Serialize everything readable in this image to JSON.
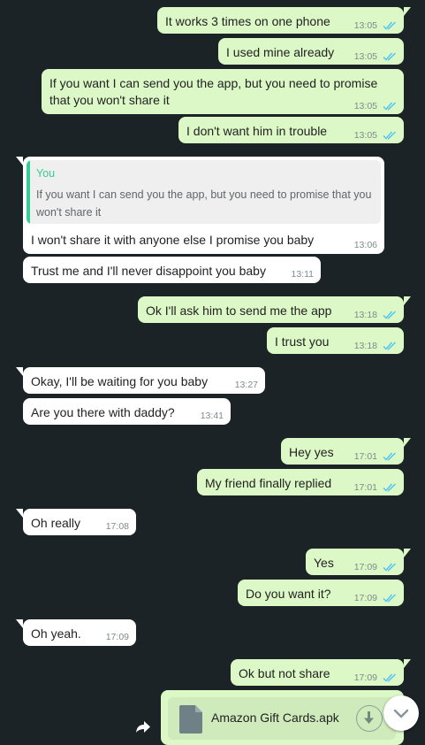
{
  "messages": [
    {
      "text": "It works 3 times on one phone",
      "time": "13:05"
    },
    {
      "text": "I used mine already",
      "time": "13:05"
    },
    {
      "text_line1": "If you want I can send you the app, but you need to promise",
      "text_line2": "that you won't share it",
      "time": "13:05"
    },
    {
      "text": "I don't want him in trouble",
      "time": "13:05"
    },
    {
      "quote_author": "You",
      "quote_text": "If you want I can send you the app, but you need to promise that you won't share it",
      "text": "I won't share it with anyone else I promise you baby",
      "time": "13:06"
    },
    {
      "text": "Trust me and I'll never disappoint you baby",
      "time": "13:11"
    },
    {
      "text": "Ok I'll ask him to send me the app",
      "time": "13:18"
    },
    {
      "text": "I trust you",
      "time": "13:18"
    },
    {
      "text": "Okay, I'll be waiting for you baby",
      "time": "13:27"
    },
    {
      "text": "Are you there with daddy?",
      "time": "13:41"
    },
    {
      "text": "Hey yes",
      "time": "17:01"
    },
    {
      "text": "My friend finally replied",
      "time": "17:01"
    },
    {
      "text": "Oh really",
      "time": "17:08"
    },
    {
      "text": "Yes",
      "time": "17:09"
    },
    {
      "text": "Do you want it?",
      "time": "17:09"
    },
    {
      "text": "Oh yeah.",
      "time": "17:09"
    },
    {
      "text": "Ok but not share",
      "time": "17:09"
    },
    {
      "file_name": "Amazon Gift Cards.apk",
      "icon": "document-icon"
    }
  ],
  "colors": {
    "background": "#1b2327",
    "outgoing_bubble": "#dcf8c6",
    "incoming_bubble": "#ffffff",
    "read_ticks": "#4fc3f7",
    "quote_accent": "#35cd96"
  }
}
